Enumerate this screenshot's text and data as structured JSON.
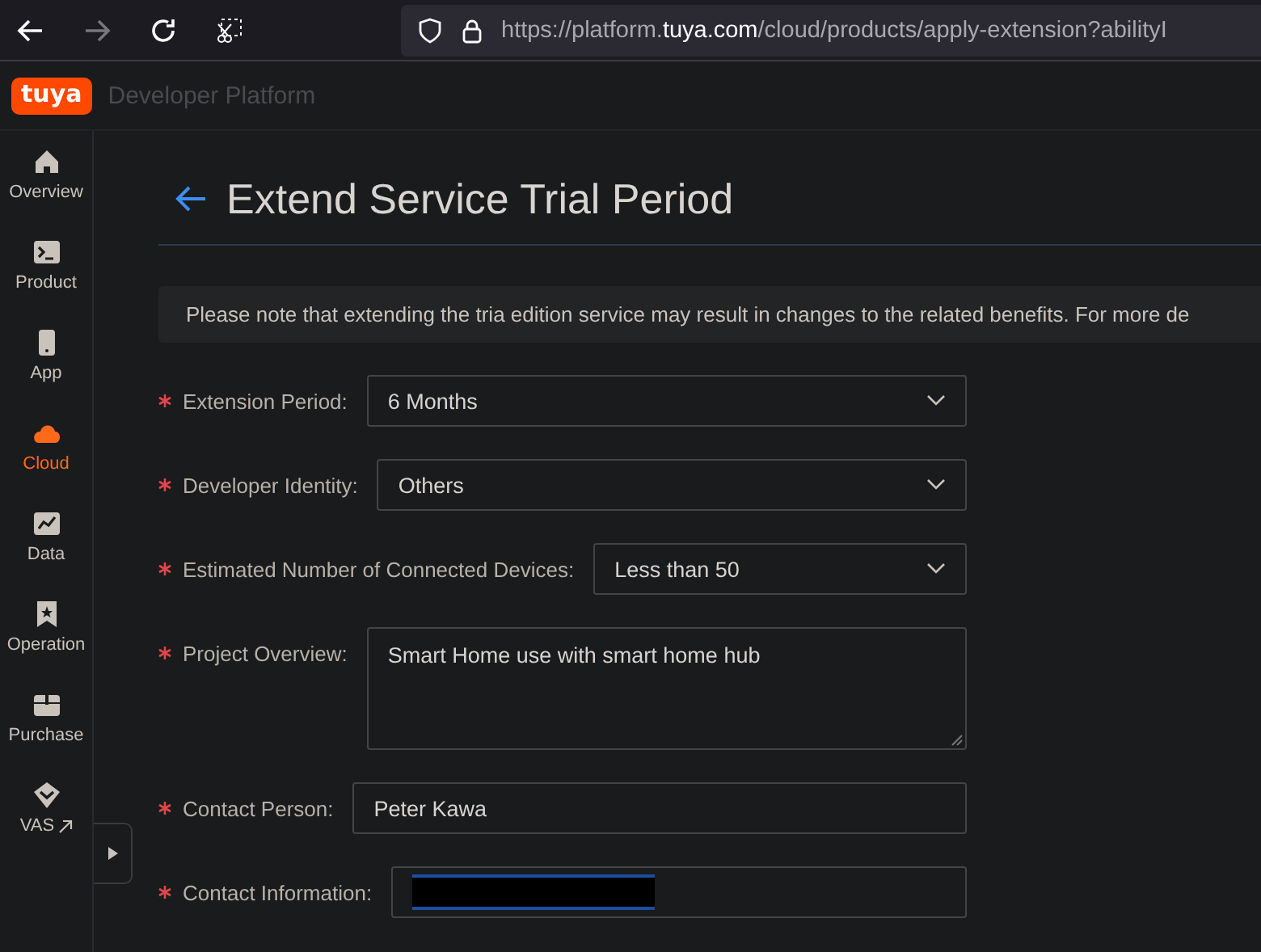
{
  "browser": {
    "url_prefix": "https://platform.",
    "url_domain": "tuya.com",
    "url_suffix": "/cloud/products/apply-extension?abilityI",
    "forward_disabled": true
  },
  "header": {
    "logo": "tuya",
    "title": "Developer Platform"
  },
  "sidebar": {
    "items": [
      {
        "label": "Overview",
        "selected": false
      },
      {
        "label": "Product",
        "selected": false
      },
      {
        "label": "App",
        "selected": false
      },
      {
        "label": "Cloud",
        "selected": true
      },
      {
        "label": "Data",
        "selected": false
      },
      {
        "label": "Operation",
        "selected": false
      },
      {
        "label": "Purchase",
        "selected": false
      },
      {
        "label": "VAS",
        "selected": false,
        "external": true
      }
    ]
  },
  "page": {
    "title": "Extend Service Trial Period",
    "notice": "Please note that extending the tria edition service may result in changes to the related benefits. For more de"
  },
  "form": [
    {
      "kind": "select",
      "label": "Extension Period:",
      "value": "6 Months",
      "required": true
    },
    {
      "kind": "select",
      "label": "Developer Identity:",
      "value": "Others",
      "required": true
    },
    {
      "kind": "select",
      "label": "Estimated Number of Connected Devices:",
      "value": "Less than 50",
      "required": true
    },
    {
      "kind": "textarea",
      "label": "Project Overview:",
      "value": "Smart Home use with smart home hub",
      "required": true
    },
    {
      "kind": "input",
      "label": "Contact Person:",
      "value": "Peter Kawa",
      "required": true
    },
    {
      "kind": "redacted",
      "label": "Contact Information:",
      "required": true
    }
  ]
}
